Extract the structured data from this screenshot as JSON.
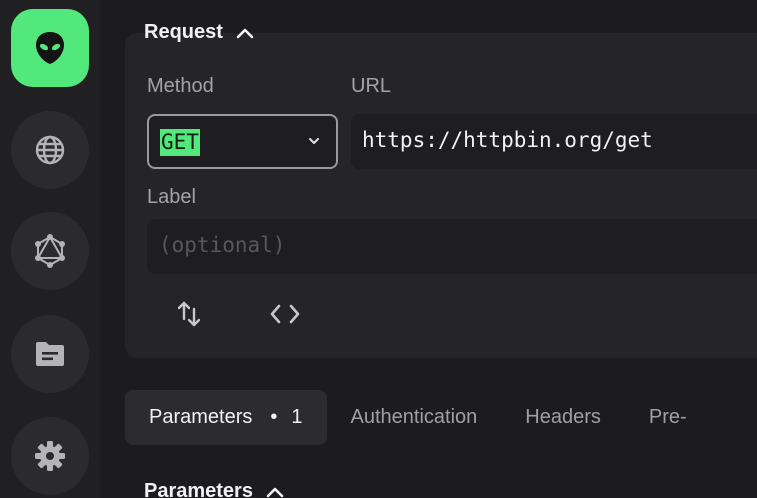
{
  "sidebar": {
    "items": [
      {
        "name": "alien-logo-icon"
      },
      {
        "name": "globe-icon"
      },
      {
        "name": "graphql-icon"
      },
      {
        "name": "folder-icon"
      },
      {
        "name": "gear-icon"
      }
    ]
  },
  "request": {
    "title": "Request",
    "method_label": "Method",
    "method_value": "GET",
    "url_label": "URL",
    "url_value": "https://httpbin.org/get",
    "label_label": "Label",
    "label_placeholder": "(optional)"
  },
  "tabs": [
    {
      "label": "Parameters",
      "dot": "•",
      "count": "1"
    },
    {
      "label": "Authentication"
    },
    {
      "label": "Headers"
    },
    {
      "label": "Pre-"
    }
  ],
  "parameters": {
    "title": "Parameters"
  },
  "colors": {
    "accent": "#52e87c",
    "background": "#1c1c1e",
    "card": "#252527"
  }
}
